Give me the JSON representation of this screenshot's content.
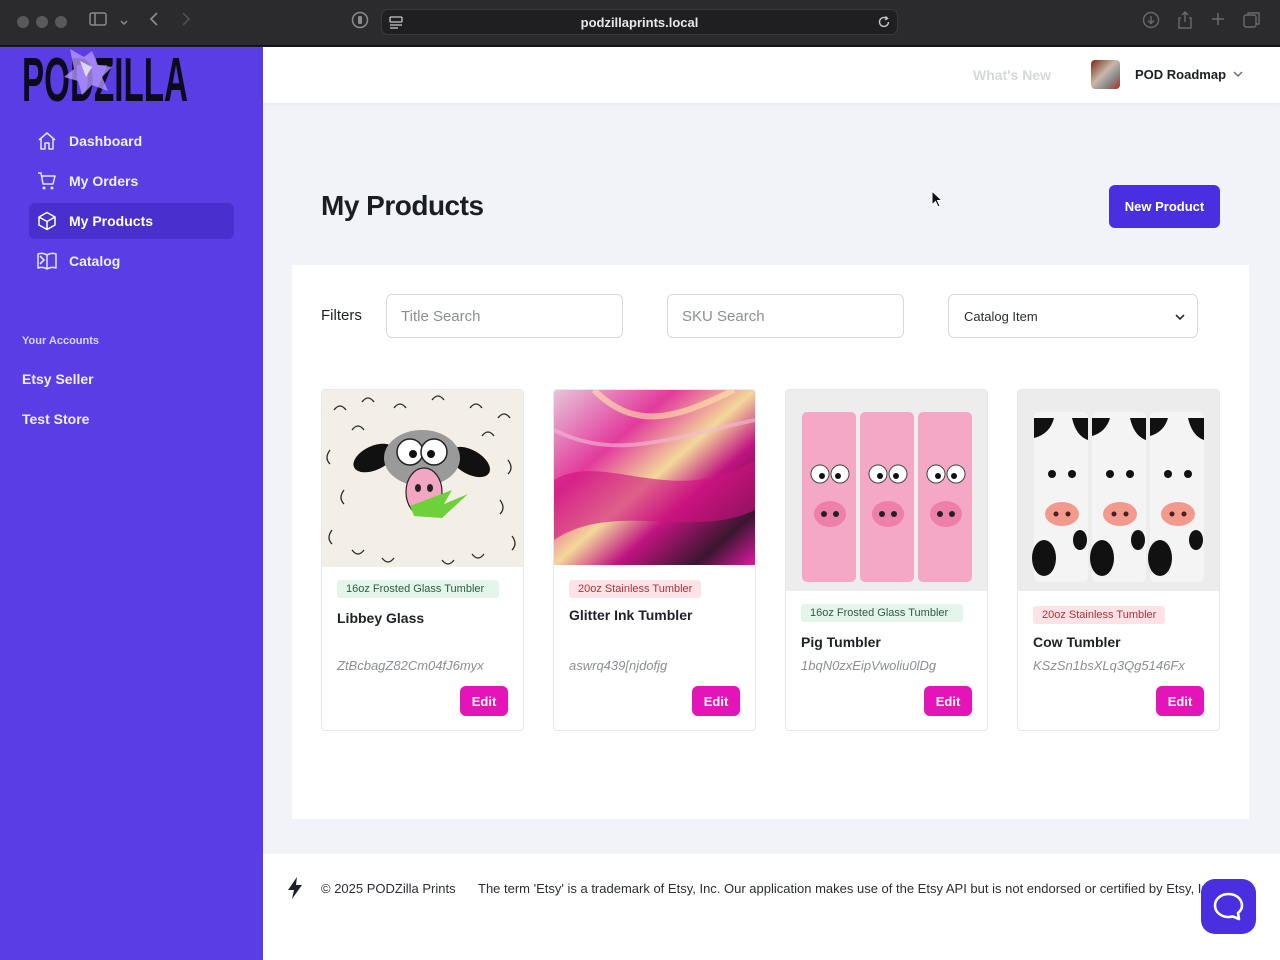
{
  "browser": {
    "url": "podzillaprints.local"
  },
  "sidebar": {
    "logo_text": "PODZILLA",
    "items": [
      {
        "label": "Dashboard",
        "icon": "home-icon"
      },
      {
        "label": "My Orders",
        "icon": "cart-icon"
      },
      {
        "label": "My Products",
        "icon": "cube-icon",
        "active": true
      },
      {
        "label": "Catalog",
        "icon": "book-icon"
      }
    ],
    "accounts_heading": "Your Accounts",
    "accounts": [
      "Etsy Seller",
      "Test Store"
    ]
  },
  "header": {
    "whats_new": "What's New",
    "user_name": "POD Roadmap"
  },
  "page": {
    "title": "My Products",
    "new_button": "New Product"
  },
  "filters": {
    "label": "Filters",
    "title_search_placeholder": "Title Search",
    "sku_search_placeholder": "SKU Search",
    "catalog_select_value": "Catalog Item"
  },
  "products": [
    {
      "badge": "16oz Frosted Glass Tumbler",
      "badge_type": "glass",
      "title": "Libbey Glass",
      "sku": "ZtBcbagZ82Cm04fJ6myx",
      "edit": "Edit"
    },
    {
      "badge": "20oz Stainless Tumbler",
      "badge_type": "steel",
      "title": "Glitter Ink Tumbler",
      "sku": "aswrq439[njdofjg",
      "edit": "Edit"
    },
    {
      "badge": "16oz Frosted Glass Tumbler",
      "badge_type": "glass",
      "title": "Pig Tumbler",
      "sku": "1bqN0zxEipVwoliu0lDg",
      "edit": "Edit"
    },
    {
      "badge": "20oz Stainless Tumbler",
      "badge_type": "steel",
      "title": "Cow Tumbler",
      "sku": "KSzSn1bsXLq3Qg5146Fx",
      "edit": "Edit"
    }
  ],
  "footer": {
    "copyright": "© 2025 PODZilla Prints",
    "legal": "The term 'Etsy' is a trademark of Etsy, Inc. Our application makes use of the Etsy API but is not endorsed or certified by Etsy, Inc."
  },
  "colors": {
    "sidebar": "#5b3de6",
    "primary_button": "#4a2fe0",
    "edit_button": "#e414b8",
    "page_bg": "#f1f3f9"
  }
}
